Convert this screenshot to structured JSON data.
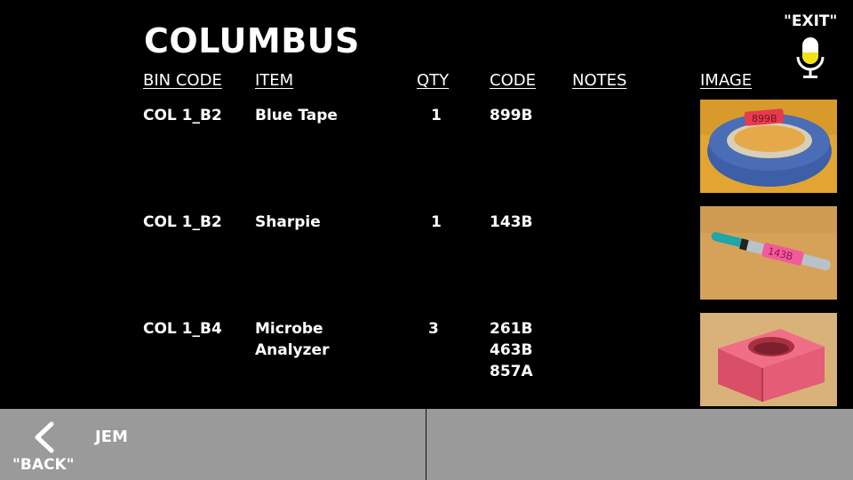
{
  "header": {
    "title": "COLUMBUS",
    "exit_label": "\"EXIT\""
  },
  "table": {
    "columns": {
      "bin_code": "BIN CODE",
      "item": "ITEM",
      "qty": "QTY",
      "code": "CODE",
      "notes": "NOTES",
      "image": "IMAGE"
    },
    "rows": [
      {
        "bin_code": "COL 1_B2",
        "item": "Blue Tape",
        "qty": "1",
        "code": "899B",
        "notes": "",
        "image": "blue-tape-photo"
      },
      {
        "bin_code": "COL 1_B2",
        "item": "Sharpie",
        "qty": "1",
        "code": "143B",
        "notes": "",
        "image": "sharpie-photo"
      },
      {
        "bin_code": "COL 1_B4",
        "item": "Microbe\nAnalyzer",
        "qty": "3",
        "code": "261B\n463B\n857A",
        "notes": "",
        "image": "microbe-analyzer-photo"
      }
    ]
  },
  "footer": {
    "back_label": "\"BACK\"",
    "crumb": "JEM"
  },
  "icons": {
    "mic": "microphone-icon",
    "back": "chevron-left-icon"
  },
  "colors": {
    "background": "#000000",
    "footer": "#9a9a9a",
    "mic_accent": "#f2e318"
  }
}
